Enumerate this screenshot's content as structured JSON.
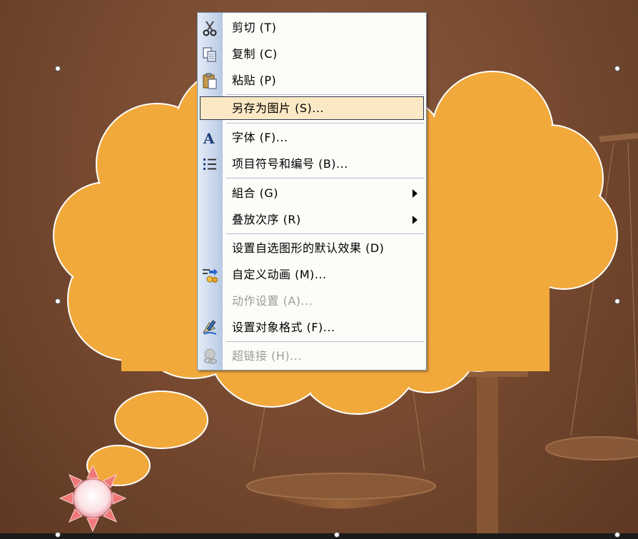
{
  "menu": {
    "items": [
      {
        "id": "cut",
        "label": "剪切 (T)",
        "icon": "scissors-icon",
        "enabled": true
      },
      {
        "id": "copy",
        "label": "复制 (C)",
        "icon": "copy-icon",
        "enabled": true
      },
      {
        "id": "paste",
        "label": "粘贴 (P)",
        "icon": "paste-icon",
        "enabled": true
      },
      {
        "id": "save-as-picture",
        "label": "另存为图片 (S)...",
        "icon": "",
        "enabled": true,
        "highlighted": true
      },
      {
        "id": "font",
        "label": "字体 (F)...",
        "icon": "font-icon",
        "enabled": true
      },
      {
        "id": "bullets-numbering",
        "label": "项目符号和编号 (B)...",
        "icon": "bullets-icon",
        "enabled": true
      },
      {
        "id": "group",
        "label": "組合 (G)",
        "icon": "",
        "enabled": true,
        "submenu": true
      },
      {
        "id": "order",
        "label": "叠放次序 (R)",
        "icon": "",
        "enabled": true,
        "submenu": true
      },
      {
        "id": "set-default-effect",
        "label": "设置自选图形的默认效果 (D)",
        "icon": "",
        "enabled": true
      },
      {
        "id": "custom-animation",
        "label": "自定义动画 (M)...",
        "icon": "custom-animation-icon",
        "enabled": true
      },
      {
        "id": "action-settings",
        "label": "动作设置 (A)...",
        "icon": "",
        "enabled": false
      },
      {
        "id": "format-object",
        "label": "设置对象格式 (F)...",
        "icon": "format-object-icon",
        "enabled": true
      },
      {
        "id": "hyperlink",
        "label": "超链接 (H)...",
        "icon": "hyperlink-icon",
        "enabled": false
      }
    ]
  },
  "colors": {
    "background": "#7a4c32",
    "cloud_fill": "#f2a93b",
    "cloud_outline": "#ffffff",
    "menu_highlight": "#fbe8c4",
    "menu_strip": "#cad8ec",
    "disabled_text": "#9c9c9c"
  }
}
